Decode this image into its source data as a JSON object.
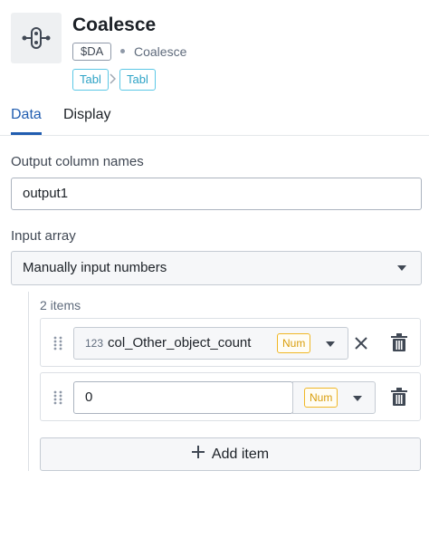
{
  "node": {
    "title": "Coalesce",
    "id_badge": "$DA",
    "subtitle": "Coalesce",
    "input_type": "Tabl",
    "output_type": "Tabl"
  },
  "tabs": [
    {
      "label": "Data",
      "active": true
    },
    {
      "label": "Display",
      "active": false
    }
  ],
  "form": {
    "output_label": "Output column names",
    "output_value": "output1",
    "input_array_label": "Input array",
    "input_array_value": "Manually input numbers",
    "items_count": "2 items",
    "items": [
      {
        "kind": "column",
        "type_prefix": "123",
        "value": "col_Other_object_count",
        "type_tag": "Num"
      },
      {
        "kind": "constant",
        "value": "0",
        "type_tag": "Num"
      }
    ],
    "add_item_label": "Add item"
  },
  "colors": {
    "accent": "#215db0",
    "type_tag": "#2ea3c6",
    "num_tag": "#d99e0b"
  },
  "icons": [
    "coalesce-node-icon",
    "chevron-right-icon",
    "drag-handle-icon",
    "caret-down-icon",
    "close-icon",
    "trash-icon",
    "plus-icon"
  ]
}
